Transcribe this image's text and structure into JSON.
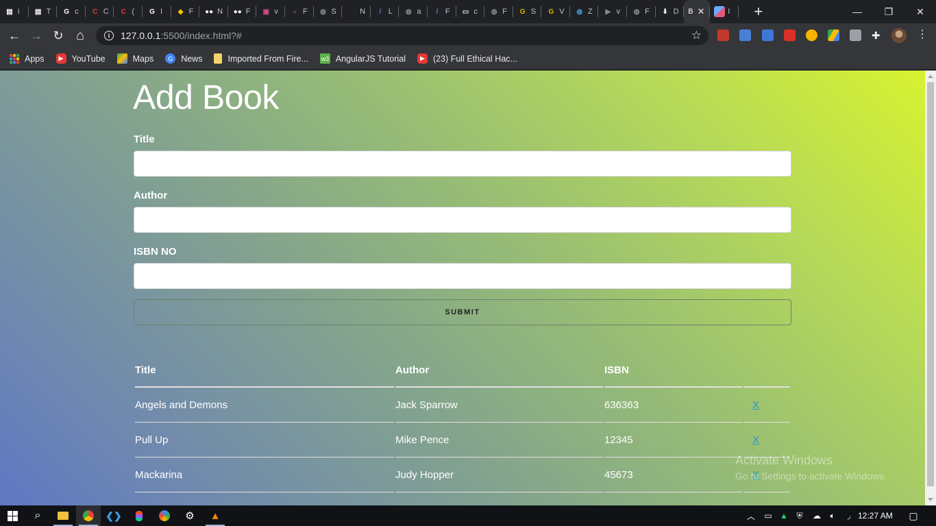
{
  "browser": {
    "tabs": [
      {
        "initial": "i",
        "color": "#ffffff",
        "glyph": "▤"
      },
      {
        "initial": "T",
        "color": "#ffffff",
        "glyph": "▤"
      },
      {
        "initial": "c",
        "color": "#ffffff",
        "glyph": "G"
      },
      {
        "initial": "C",
        "color": "#e53935",
        "glyph": "C"
      },
      {
        "initial": "(",
        "color": "#e53935",
        "glyph": "C"
      },
      {
        "initial": "I",
        "color": "#ffffff",
        "glyph": "G"
      },
      {
        "initial": "F",
        "color": "#f2c400",
        "glyph": "◆"
      },
      {
        "initial": "N",
        "color": "#ffffff",
        "glyph": "●●"
      },
      {
        "initial": "F",
        "color": "#ffffff",
        "glyph": "●●"
      },
      {
        "initial": "v",
        "color": "#d84b8b",
        "glyph": "▣"
      },
      {
        "initial": "F",
        "color": "#444444",
        "glyph": "●"
      },
      {
        "initial": "S",
        "color": "#8a8d91",
        "glyph": "◍"
      },
      {
        "initial": "N",
        "color": "#202124",
        "glyph": ""
      },
      {
        "initial": "L",
        "color": "#5a7fc0",
        "glyph": "/"
      },
      {
        "initial": "a",
        "color": "#8a8d91",
        "glyph": "◍"
      },
      {
        "initial": "F",
        "color": "#5a7fc0",
        "glyph": "/"
      },
      {
        "initial": "c",
        "color": "#e8eaed",
        "glyph": "▭"
      },
      {
        "initial": "F",
        "color": "#8a8d91",
        "glyph": "◍"
      },
      {
        "initial": "S",
        "color": "#e0b400",
        "glyph": "G"
      },
      {
        "initial": "V",
        "color": "#e0b400",
        "glyph": "G"
      },
      {
        "initial": "Z",
        "color": "#39a0e0",
        "glyph": "◍"
      },
      {
        "initial": "v",
        "color": "#8a8d91",
        "glyph": "▶"
      },
      {
        "initial": "F",
        "color": "#8a8d91",
        "glyph": "◍"
      },
      {
        "initial": "D",
        "color": "#e8eaed",
        "glyph": "⬇"
      }
    ],
    "active_tab": {
      "initial": "B",
      "close": "✕"
    },
    "last_tab": {
      "initial": "I",
      "color": "#e05a7a"
    },
    "new_tab": "+",
    "window_controls": {
      "minimize": "—",
      "maximize": "❐",
      "close": "✕"
    },
    "nav": {
      "back": "←",
      "forward": "→",
      "reload": "↻",
      "home": "⌂"
    },
    "url": {
      "host": "127.0.0.1",
      "rest": ":5500/index.html?#"
    },
    "bookmarks": [
      {
        "label": "Apps",
        "icon": "apps-grid"
      },
      {
        "label": "YouTube",
        "icon": "youtube-icon",
        "color": "#e53935"
      },
      {
        "label": "Maps",
        "icon": "maps-icon",
        "color": "#34a853"
      },
      {
        "label": "News",
        "icon": "news-icon",
        "color": "#4285f4"
      },
      {
        "label": "Imported From Fire...",
        "icon": "folder-icon",
        "color": "#f6d36a"
      },
      {
        "label": "AngularJS Tutorial",
        "icon": "tutorial-icon",
        "color": "#5fb14a"
      },
      {
        "label": "(23) Full Ethical Hac...",
        "icon": "youtube-icon",
        "color": "#e53935"
      }
    ]
  },
  "page": {
    "heading": "Add Book",
    "form": {
      "title_label": "Title",
      "title_value": "",
      "author_label": "Author",
      "author_value": "",
      "isbn_label": "ISBN NO",
      "isbn_value": "",
      "submit_label": "SUBMIT"
    },
    "table": {
      "headers": [
        "Title",
        "Author",
        "ISBN",
        ""
      ],
      "rows": [
        {
          "title": "Angels and Demons",
          "author": "Jack Sparrow",
          "isbn": "636363",
          "delete": "X"
        },
        {
          "title": "Pull Up",
          "author": "Mike Pence",
          "isbn": "12345",
          "delete": "X"
        },
        {
          "title": "Mackarina",
          "author": "Judy Hopper",
          "isbn": "45673",
          "delete": "X"
        }
      ]
    },
    "watermark": {
      "line1": "Activate Windows",
      "line2": "Go to Settings to activate Windows."
    }
  },
  "taskbar": {
    "time": "12:27 AM"
  }
}
